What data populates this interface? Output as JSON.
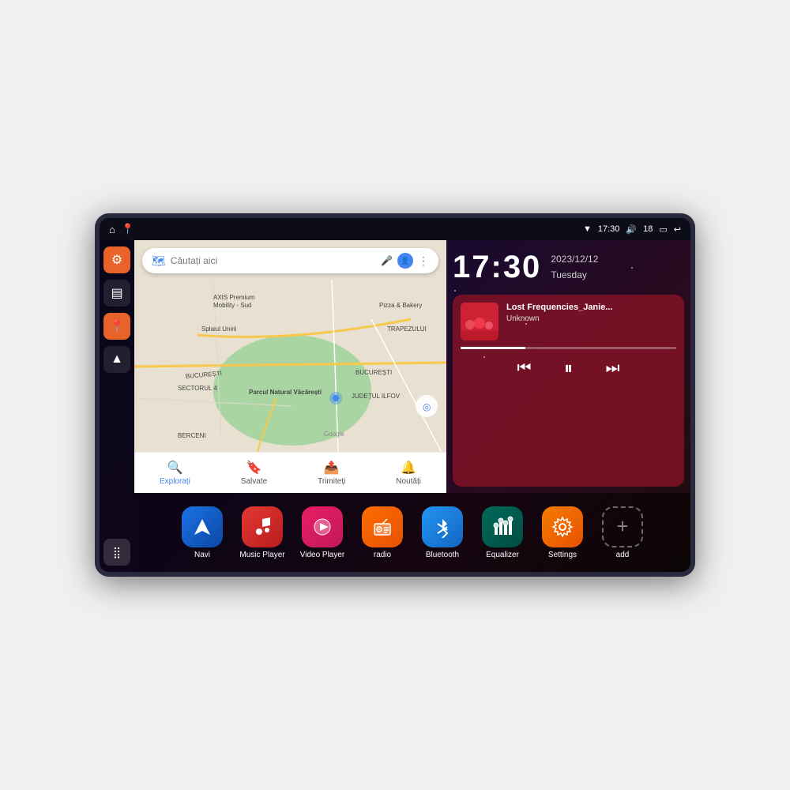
{
  "device": {
    "title": "Car Android Head Unit"
  },
  "statusBar": {
    "wifi_icon": "▼",
    "time": "17:30",
    "volume_icon": "🔊",
    "battery_level": "18",
    "battery_icon": "🔋",
    "back_icon": "↩"
  },
  "sidebar": {
    "settings_icon": "⚙",
    "files_icon": "▤",
    "maps_icon": "📍",
    "nav_icon": "▲",
    "grid_icon": "⋮⋮"
  },
  "map": {
    "search_placeholder": "Căutați aici",
    "nav_items": [
      {
        "label": "Explorați",
        "icon": "📍",
        "active": true
      },
      {
        "label": "Salvate",
        "icon": "🔖",
        "active": false
      },
      {
        "label": "Trimiteți",
        "icon": "📤",
        "active": false
      },
      {
        "label": "Noutăți",
        "icon": "🔔",
        "active": false
      }
    ],
    "labels": [
      "AXIS Premium Mobility - Sud",
      "Parcul Natural Văcărești",
      "Pizza & Bakery",
      "BUCUREȘTI SECTORUL 4",
      "BUCUREȘTI",
      "JUDEȚUL ILFOV",
      "BERCENI",
      "TRAPEZULUI"
    ]
  },
  "clock": {
    "time": "17:30",
    "date": "2023/12/12",
    "day": "Tuesday"
  },
  "music": {
    "title": "Lost Frequencies_Janie...",
    "artist": "Unknown",
    "prev_icon": "⏮",
    "play_icon": "⏸",
    "next_icon": "⏭",
    "progress": 30
  },
  "apps": [
    {
      "id": "navi",
      "label": "Navi",
      "icon": "▲",
      "color_class": "blue-grad"
    },
    {
      "id": "music_player",
      "label": "Music Player",
      "icon": "♪",
      "color_class": "red-grad"
    },
    {
      "id": "video_player",
      "label": "Video Player",
      "icon": "▶",
      "color_class": "red-pink"
    },
    {
      "id": "radio",
      "label": "radio",
      "icon": "📻",
      "color_class": "orange-red"
    },
    {
      "id": "bluetooth",
      "label": "Bluetooth",
      "icon": "⚡",
      "color_class": "blue-light"
    },
    {
      "id": "equalizer",
      "label": "Equalizer",
      "icon": "▐║",
      "color_class": "dark-teal"
    },
    {
      "id": "settings",
      "label": "Settings",
      "icon": "⚙",
      "color_class": "orange-br"
    },
    {
      "id": "add",
      "label": "add",
      "icon": "+",
      "color_class": "grey-add"
    }
  ]
}
